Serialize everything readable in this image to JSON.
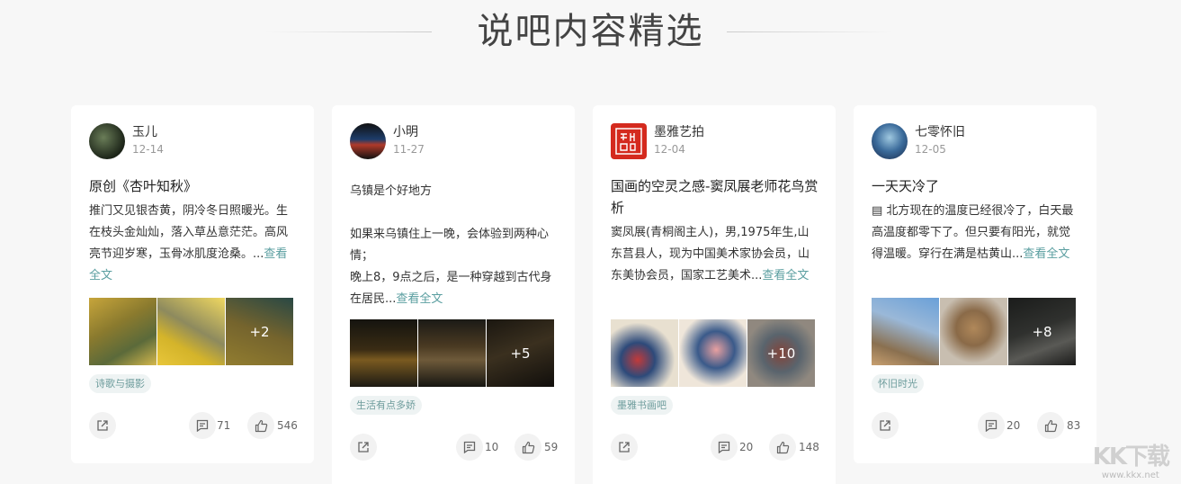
{
  "section": {
    "title": "说吧内容精选"
  },
  "cards": [
    {
      "user": "玉儿",
      "date": "12-14",
      "title": "原创《杏叶知秋》",
      "body": "推门又见银杏黄，阴冷冬日照暖光。生在枝头金灿灿，落入草丛意茫茫。高风亮节迎岁寒，玉骨冰肌度沧桑。...",
      "more": "查看全文",
      "more_count": "+2",
      "tag": "诗歌与摄影",
      "comments": "71",
      "likes": "546"
    },
    {
      "user": "小明",
      "date": "11-27",
      "title": "",
      "body": "乌镇是个好地方\n\n如果来乌镇住上一晚，会体验到两种心情；\n晚上8，9点之后，是一种穿越到古代身在居民...",
      "more": "查看全文",
      "more_count": "+5",
      "tag": "生活有点多娇",
      "comments": "10",
      "likes": "59"
    },
    {
      "user": "墨雅艺拍",
      "date": "12-04",
      "title": "国画的空灵之感-窦凤展老师花鸟赏析",
      "body": "窦凤展(青桐阁主人)，男,1975年生,山东莒县人，现为中国美术家协会员，山东美协会员，国家工艺美术...",
      "more": "查看全文",
      "more_count": "+10",
      "tag": "墨雅书画吧",
      "comments": "20",
      "likes": "148"
    },
    {
      "user": "七零怀旧",
      "date": "12-05",
      "title": "一天天冷了",
      "body": "▤ 北方现在的温度已经很冷了，白天最高温度都零下了。但只要有阳光，就觉得温暖。穿行在满是枯黄山...",
      "more": "查看全文",
      "more_count": "+8",
      "tag": "怀旧时光",
      "comments": "20",
      "likes": "83"
    }
  ],
  "watermark": {
    "logo": "KK下载",
    "url": "www.kkx.net"
  },
  "icons": {
    "share": "share-icon",
    "comment": "comment-icon",
    "like": "thumbs-up-icon"
  }
}
